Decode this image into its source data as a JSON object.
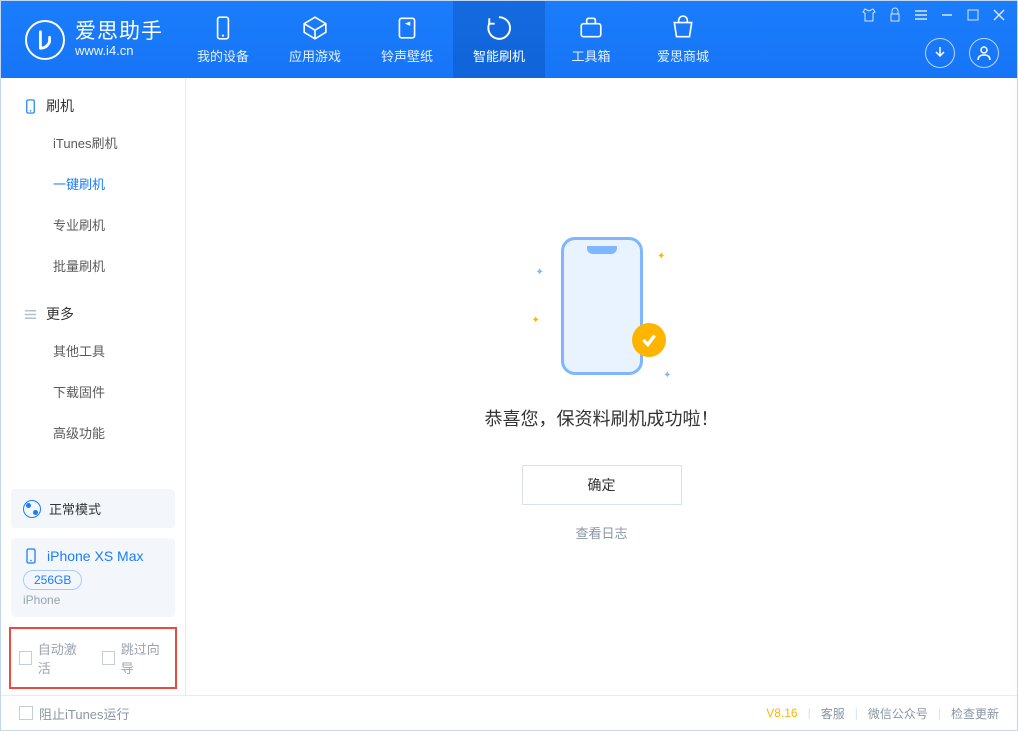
{
  "app": {
    "title": "爱思助手",
    "subtitle": "www.i4.cn"
  },
  "nav": {
    "device": "我的设备",
    "apps": "应用游戏",
    "ringtone": "铃声壁纸",
    "flash": "智能刷机",
    "toolbox": "工具箱",
    "store": "爱思商城"
  },
  "sidebar": {
    "section_flash": "刷机",
    "items_flash": {
      "itunes": "iTunes刷机",
      "onekey": "一键刷机",
      "pro": "专业刷机",
      "batch": "批量刷机"
    },
    "section_more": "更多",
    "items_more": {
      "other": "其他工具",
      "firmware": "下载固件",
      "advanced": "高级功能"
    },
    "mode": "正常模式",
    "device_name": "iPhone XS Max",
    "device_capacity": "256GB",
    "device_type": "iPhone",
    "auto_activate": "自动激活",
    "skip_guide": "跳过向导"
  },
  "main": {
    "success": "恭喜您，保资料刷机成功啦！",
    "ok": "确定",
    "view_log": "查看日志"
  },
  "status": {
    "block_itunes": "阻止iTunes运行",
    "version": "V8.16",
    "support": "客服",
    "wechat": "微信公众号",
    "update": "检查更新"
  }
}
